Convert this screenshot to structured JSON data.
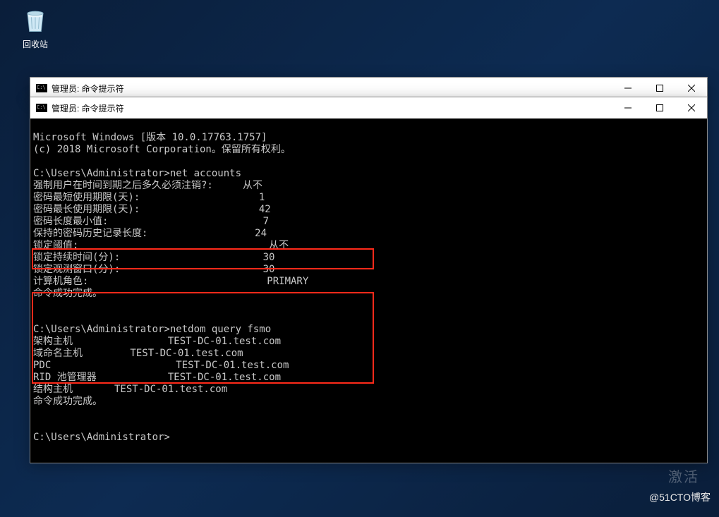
{
  "desktop": {
    "recycle_bin": "回收站"
  },
  "window_back": {
    "title": "管理员: 命令提示符"
  },
  "window_front": {
    "title": "管理员: 命令提示符"
  },
  "terminal": {
    "header1": "Microsoft Windows [版本 10.0.17763.1757]",
    "header2": "(c) 2018 Microsoft Corporation。保留所有权利。",
    "prompt1": "C:\\Users\\Administrator>net accounts",
    "na_l1": "强制用户在时间到期之后多久必须注销?:     从不",
    "na_l2": "密码最短使用期限(天):                    1",
    "na_l3": "密码最长使用期限(天):                    42",
    "na_l4": "密码长度最小值:                          7",
    "na_l5": "保持的密码历史记录长度:                  24",
    "na_l6": "锁定阈值:                                从不",
    "na_l7": "锁定持续时间(分):                        30",
    "na_l8": "锁定观测窗口(分):                        30",
    "na_l9": "计算机角色:                              PRIMARY",
    "na_l10": "命令成功完成。",
    "prompt2": "C:\\Users\\Administrator>netdom query fsmo",
    "fs_l1": "架构主机                TEST-DC-01.test.com",
    "fs_l2": "域命名主机        TEST-DC-01.test.com",
    "fs_l3": "PDC                     TEST-DC-01.test.com",
    "fs_l4": "RID 池管理器            TEST-DC-01.test.com",
    "fs_l5": "结构主机       TEST-DC-01.test.com",
    "fs_l6": "命令成功完成。",
    "prompt3": "C:\\Users\\Administrator>"
  },
  "watermark": "@51CTO博客",
  "activate": "激活"
}
